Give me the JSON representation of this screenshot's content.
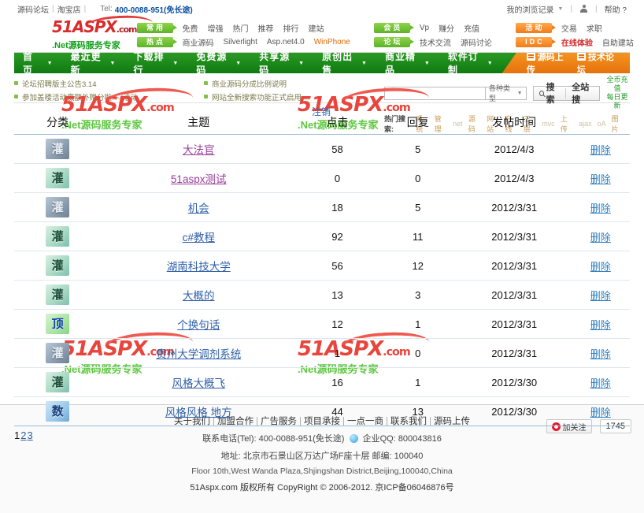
{
  "topbar": {
    "forum_link": "源码论坛",
    "shop_link": "淘宝店",
    "tel_label": "Tel:",
    "tel_number": "400-0088-951(免长途)",
    "history_link": "我的浏览记录",
    "help_link": "帮助 ?"
  },
  "brand": {
    "logo_51": "51A",
    "logo_spx": "SPX",
    "logo_domain": ".com",
    "tagline": ".Net源码服务专家"
  },
  "quicknav": {
    "groups": [
      {
        "tag": "常用",
        "links": [
          "免费",
          "增强",
          "热门",
          "推荐",
          "排行",
          "建站"
        ]
      },
      {
        "tag": "热点",
        "links": [
          "商业源码",
          "Silverlight",
          "Asp.net4.0",
          "WinPhone"
        ]
      },
      {
        "tag": "会员",
        "links": [
          "Vp",
          "赚分",
          "充值"
        ]
      },
      {
        "tag": "论坛",
        "links": [
          "技术交流",
          "源码讨论"
        ]
      },
      {
        "tag": "活动",
        "links": [
          "交易",
          "求职"
        ]
      },
      {
        "tag": "IDC",
        "links": [
          "在线体验",
          "自助建站"
        ]
      }
    ]
  },
  "mainnav": {
    "items": [
      "首 页",
      "最近更新",
      "下载排行",
      "免费源码",
      "共享源码",
      "原创出售",
      "商业精品",
      "软件订制"
    ],
    "right_items": [
      "源码上传",
      "技术论坛"
    ]
  },
  "notices": [
    "论坛招聘版主公告3.14",
    "商业源码分成比例说明",
    "参加盖楼活动赢额外赠分啦! ~(活动",
    "网站全新搜索功能正式启用"
  ],
  "search": {
    "input_value": "",
    "placeholder": "",
    "type_label": "各种类型",
    "search_button": "搜索",
    "site_search_button": "全站搜",
    "promo_line1": "全币充值",
    "promo_line2": "每日更新",
    "hot_label": "热门搜索:",
    "hot_keywords": [
      "系统",
      "管理",
      "net",
      "源码",
      "网站",
      "在线",
      "三层",
      "mvc",
      "上传",
      "ajax",
      "oA",
      "图片"
    ]
  },
  "content": {
    "logout_label": "注销",
    "table": {
      "headers": [
        "分类",
        "主题",
        "点击",
        "回复",
        "发帖时间",
        ""
      ],
      "rows": [
        {
          "cat": "灌",
          "cat_style": "shui",
          "topic": "大法官",
          "visited": true,
          "hits": "58",
          "replies": "5",
          "date": "2012/4/3",
          "action": "删除"
        },
        {
          "cat": "灌",
          "cat_style": "guan",
          "topic": "51aspx测试",
          "visited": true,
          "hits": "0",
          "replies": "0",
          "date": "2012/4/3",
          "action": "删除"
        },
        {
          "cat": "灌",
          "cat_style": "shui",
          "topic": "机会",
          "visited": false,
          "hits": "18",
          "replies": "5",
          "date": "2012/3/31",
          "action": "删除"
        },
        {
          "cat": "灌",
          "cat_style": "guan",
          "topic": "c#教程",
          "visited": false,
          "hits": "92",
          "replies": "11",
          "date": "2012/3/31",
          "action": "删除"
        },
        {
          "cat": "灌",
          "cat_style": "guan",
          "topic": "湖南科技大学",
          "visited": false,
          "hits": "56",
          "replies": "12",
          "date": "2012/3/31",
          "action": "删除"
        },
        {
          "cat": "灌",
          "cat_style": "guan",
          "topic": "大概的",
          "visited": false,
          "hits": "13",
          "replies": "3",
          "date": "2012/3/31",
          "action": "删除"
        },
        {
          "cat": "顶",
          "cat_style": "ding",
          "topic": "个换句话",
          "visited": false,
          "hits": "12",
          "replies": "1",
          "date": "2012/3/31",
          "action": "删除"
        },
        {
          "cat": "灌",
          "cat_style": "shui",
          "topic": "贵州大学调剂系统",
          "visited": false,
          "hits": "1",
          "replies": "0",
          "date": "2012/3/31",
          "action": "删除"
        },
        {
          "cat": "灌",
          "cat_style": "guan",
          "topic": "风格大概飞",
          "visited": false,
          "hits": "16",
          "replies": "1",
          "date": "2012/3/30",
          "action": "删除"
        },
        {
          "cat": "数",
          "cat_style": "shu",
          "topic": "风格风格 地方",
          "visited": false,
          "hits": "44",
          "replies": "13",
          "date": "2012/3/30",
          "action": "删除"
        }
      ]
    },
    "pager": {
      "current": "1",
      "links": [
        "2",
        "3"
      ]
    }
  },
  "watermark": {
    "main_51": "51A",
    "main_spx": "SPX",
    "domain": ".com",
    "sub": ".Net源码服务专家"
  },
  "footer": {
    "links": [
      "关于我们",
      "加盟合作",
      "广告服务",
      "项目承接",
      "一点一商",
      "联系我们",
      "源码上传"
    ],
    "tel_line_label": "联系电话(Tel): 400-0088-951(免长途)",
    "qq_line": "企业QQ: 800043816",
    "address_cn": "地址: 北京市石景山区万达广场F座十层  邮编: 100040",
    "address_en": "Floor 10th,West Wanda Plaza,Shjingshan District,Beijing,100040,China",
    "copyright": "51Aspx.com 版权所有  CopyRight © 2006-2012. 京ICP备06046876号",
    "weibo_label": "加关注",
    "fan_count": "1745"
  }
}
